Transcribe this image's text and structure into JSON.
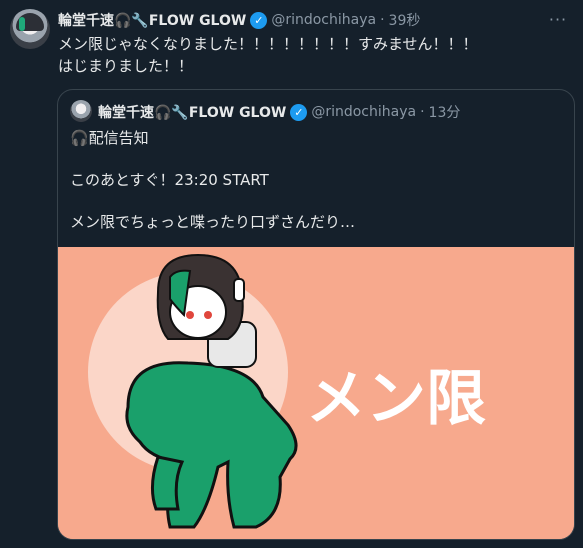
{
  "tweet": {
    "author_name": "輪堂千速🎧🔧FLOW GLOW",
    "handle": "@rindochihaya",
    "separator": "·",
    "time": "39秒",
    "more_label": "···",
    "text": "メン限じゃなくなりました！！！！！！！！すみません！！！\nはじまりました！！"
  },
  "quote": {
    "author_name": "輪堂千速🎧🔧FLOW GLOW",
    "handle": "@rindochihaya",
    "separator": "·",
    "time": "13分",
    "text": "🎧配信告知\n\nこのあとすぐ！23:20 START\n\nメン限でちょっと喋ったり口ずさんだり…",
    "image_caption": "メン限",
    "image_colors": {
      "background": "#f7a98d",
      "circle": "#fbd6c8",
      "figure": "#1aa06b"
    }
  },
  "colors": {
    "page_bg": "#15202b",
    "text": "#e7e9ea",
    "muted": "#8b98a5",
    "verified": "#1d9bf0",
    "border": "#38444d"
  }
}
